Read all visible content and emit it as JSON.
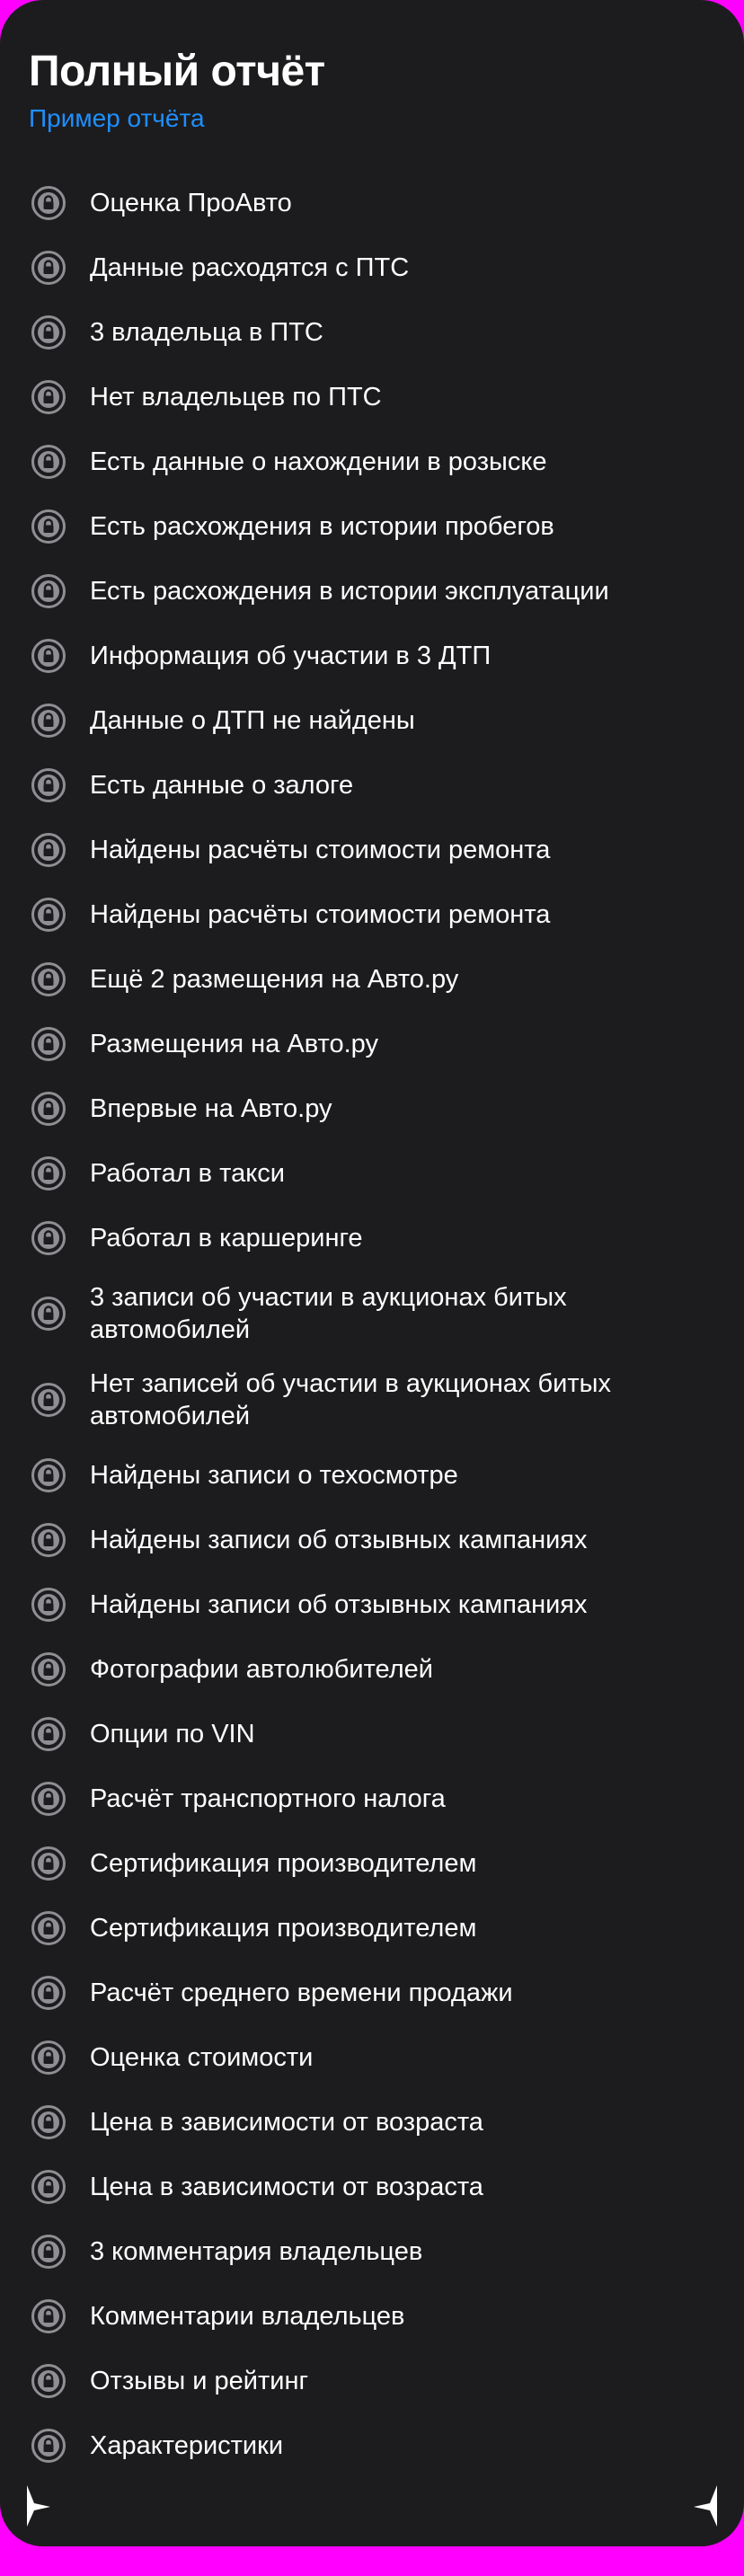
{
  "header": {
    "title": "Полный отчёт",
    "sample_link": "Пример отчёта"
  },
  "colors": {
    "background": "#1c1c1e",
    "text": "#ffffff",
    "link": "#1f8fff",
    "icon": "#8e8e93",
    "frame": "#ff00ff"
  },
  "items": [
    {
      "label": "Оценка ПроАвто",
      "icon": "lock-icon"
    },
    {
      "label": "Данные расходятся с ПТС",
      "icon": "lock-icon"
    },
    {
      "label": "3 владельца в ПТС",
      "icon": "lock-icon"
    },
    {
      "label": "Нет владельцев по ПТС",
      "icon": "lock-icon"
    },
    {
      "label": "Есть данные о нахождении в розыске",
      "icon": "lock-icon"
    },
    {
      "label": "Есть расхождения в истории пробегов",
      "icon": "lock-icon"
    },
    {
      "label": "Есть расхождения в истории эксплуатации",
      "icon": "lock-icon"
    },
    {
      "label": "Информация об участии в 3 ДТП",
      "icon": "lock-icon"
    },
    {
      "label": "Данные о ДТП не найдены",
      "icon": "lock-icon"
    },
    {
      "label": "Есть данные о залоге",
      "icon": "lock-icon"
    },
    {
      "label": "Найдены расчёты стоимости ремонта",
      "icon": "lock-icon"
    },
    {
      "label": "Найдены расчёты стоимости ремонта",
      "icon": "lock-icon"
    },
    {
      "label": "Ещё 2 размещения на Авто.ру",
      "icon": "lock-icon"
    },
    {
      "label": "Размещения на Авто.ру",
      "icon": "lock-icon"
    },
    {
      "label": "Впервые на Авто.ру",
      "icon": "lock-icon"
    },
    {
      "label": "Работал в такси",
      "icon": "lock-icon"
    },
    {
      "label": "Работал в каршеринге",
      "icon": "lock-icon"
    },
    {
      "label": "3 записи об участии в аукционах битых\nавтомобилей",
      "icon": "lock-icon"
    },
    {
      "label": "Нет записей об участии в аукционах битых\nавтомобилей",
      "icon": "lock-icon"
    },
    {
      "label": "Найдены записи о техосмотре",
      "icon": "lock-icon"
    },
    {
      "label": "Найдены записи об отзывных кампаниях",
      "icon": "lock-icon"
    },
    {
      "label": "Найдены записи об отзывных кампаниях",
      "icon": "lock-icon"
    },
    {
      "label": "Фотографии автолюбителей",
      "icon": "lock-icon"
    },
    {
      "label": "Опции по VIN",
      "icon": "lock-icon"
    },
    {
      "label": "Расчёт транспортного налога",
      "icon": "lock-icon"
    },
    {
      "label": "Сертификация производителем",
      "icon": "lock-icon"
    },
    {
      "label": "Сертификация производителем",
      "icon": "lock-icon"
    },
    {
      "label": "Расчёт среднего времени продажи",
      "icon": "lock-icon"
    },
    {
      "label": "Оценка стоимости",
      "icon": "lock-icon"
    },
    {
      "label": "Цена в зависимости от возраста",
      "icon": "lock-icon"
    },
    {
      "label": "Цена в зависимости от возраста",
      "icon": "lock-icon"
    },
    {
      "label": "3 комментария владельцев",
      "icon": "lock-icon"
    },
    {
      "label": "Комментарии владельцев",
      "icon": "lock-icon"
    },
    {
      "label": "Отзывы и рейтинг",
      "icon": "lock-icon"
    },
    {
      "label": "Характеристики",
      "icon": "lock-icon"
    }
  ]
}
